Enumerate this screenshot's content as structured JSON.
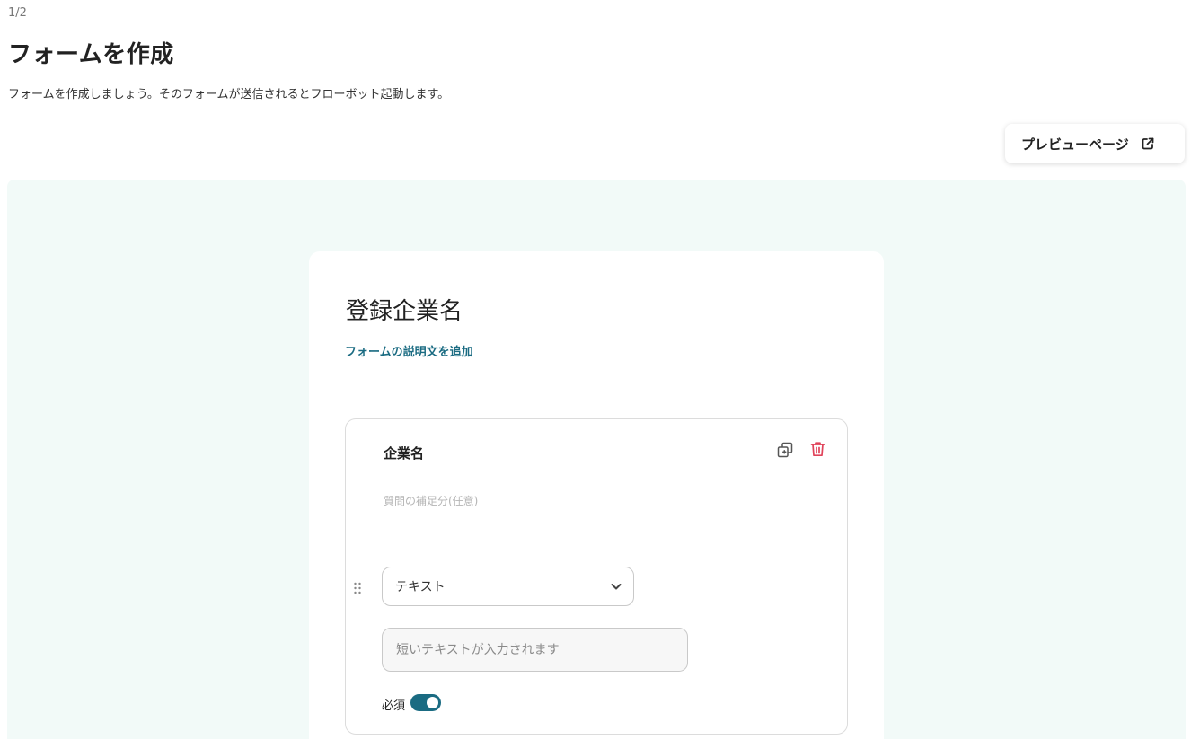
{
  "header": {
    "step": "1/2",
    "title": "フォームを作成",
    "description": "フォームを作成しましょう。そのフォームが送信されるとフローボット起動します。"
  },
  "preview": {
    "label": "プレビューページ",
    "icon": "external-link-icon"
  },
  "form": {
    "title": "登録企業名",
    "add_description_label": "フォームの説明文を追加",
    "question": {
      "title": "企業名",
      "hint": "質問の補足分(任意)",
      "type_selected": "テキスト",
      "answer_placeholder": "短いテキストが入力されます",
      "required_label": "必須",
      "required": true,
      "icons": [
        "copy-icon",
        "trash-icon",
        "drag-handle-icon",
        "chevron-down-icon"
      ]
    }
  },
  "colors": {
    "accent": "#1a6b82",
    "canvas_bg": "#f2faf8",
    "delete": "#e0435a"
  }
}
